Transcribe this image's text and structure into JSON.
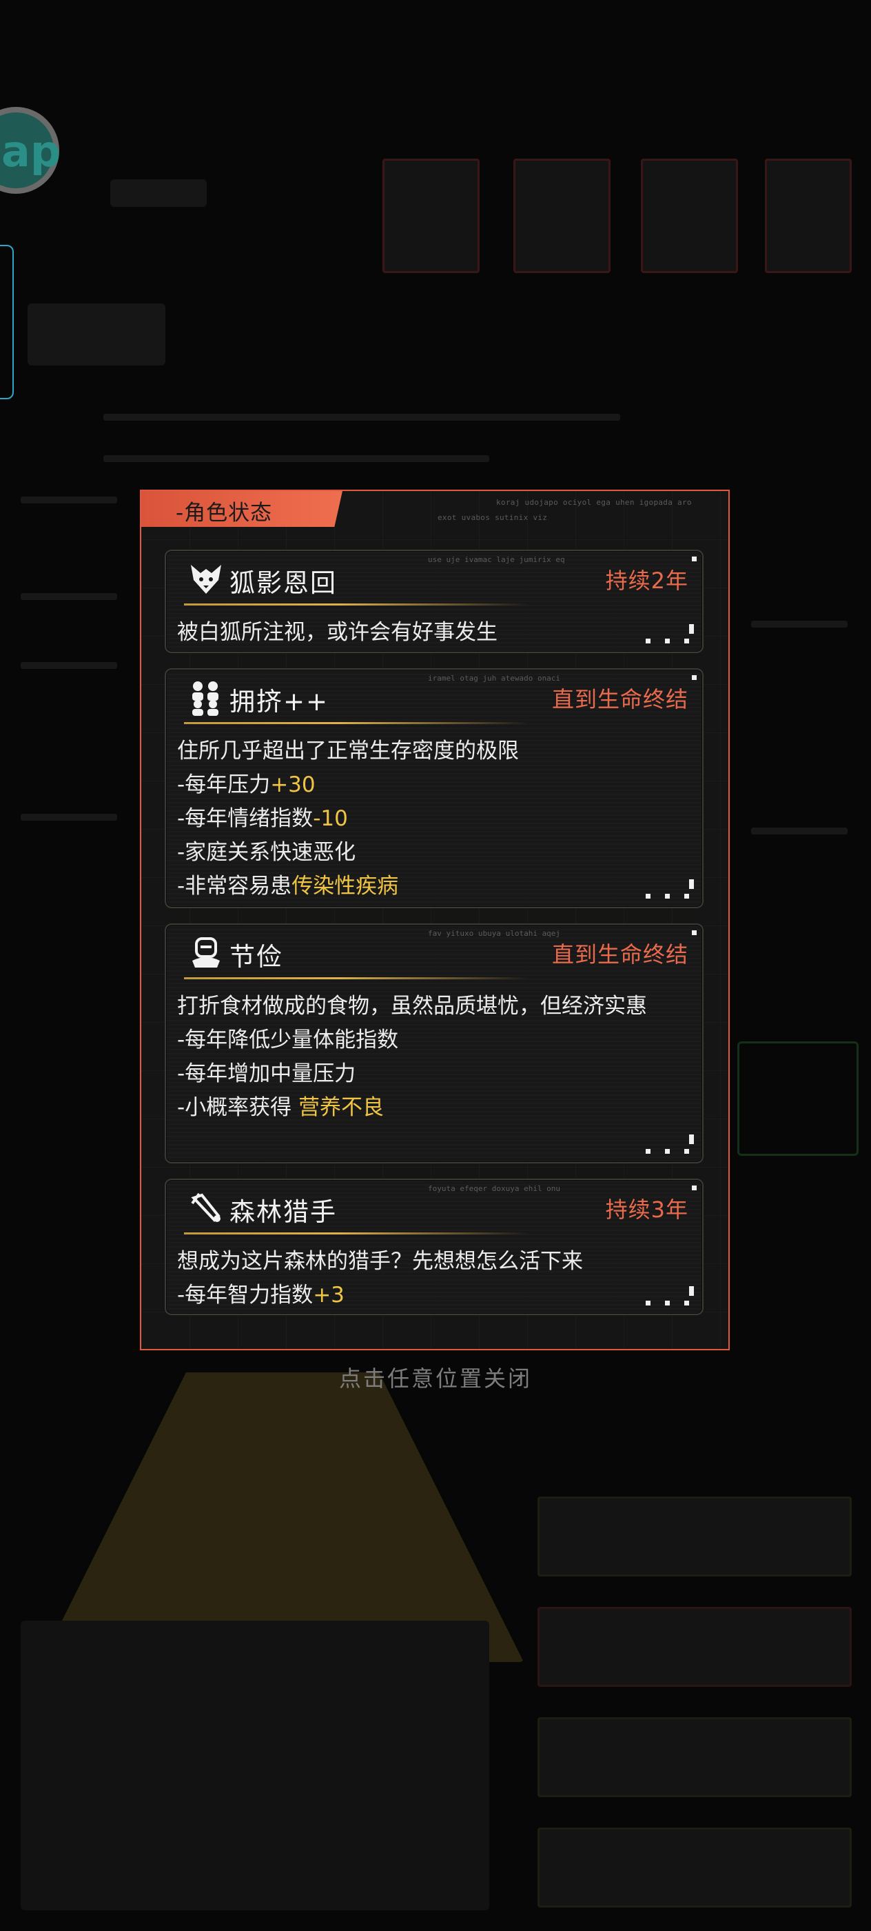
{
  "background": {
    "avatar_text": "ap"
  },
  "modal": {
    "title": "-角色状态",
    "deco_lines": [
      "koraj udojapo ociyol ega uhen igopada aro",
      "exot uvabos sutinix viz"
    ],
    "cards": [
      {
        "icon": "fox-icon",
        "name": "狐影恩回",
        "duration": "持续2年",
        "code": "use uje ivamac laje jumirix eq",
        "lines": [
          "被白狐所注视，或许会有好事发生"
        ]
      },
      {
        "icon": "crowd-icon",
        "name": "拥挤++",
        "duration": "直到生命终结",
        "code": "iramel otag juh atewado onaci",
        "lines": [
          "住所几乎超出了正常生存密度的极限",
          "-每年压力",
          "+30",
          "-每年情绪指数",
          "-10",
          "-家庭关系快速恶化",
          "-非常容易患",
          "传染性疾病"
        ]
      },
      {
        "icon": "frugal-icon",
        "name": "节俭",
        "duration": "直到生命终结",
        "code": "fav yituxo ubuya ulotahi aqej",
        "lines": [
          "打折食材做成的食物，虽然品质堪忧，但经济实惠",
          "-每年降低少量体能指数",
          "-每年增加中量压力",
          "-小概率获得 ",
          "营养不良"
        ]
      },
      {
        "icon": "hunter-icon",
        "name": "森林猎手",
        "duration": "持续3年",
        "code": "foyuta efeqer doxuya ehil onu",
        "lines": [
          "想成为这片森林的猎手？先想想怎么活下来",
          "-每年智力指数",
          "+3"
        ]
      }
    ]
  },
  "close_hint": "点击任意位置关闭",
  "colors": {
    "accent": "#e0593e",
    "highlight": "#f0c544",
    "duration": "#e96a4d"
  }
}
